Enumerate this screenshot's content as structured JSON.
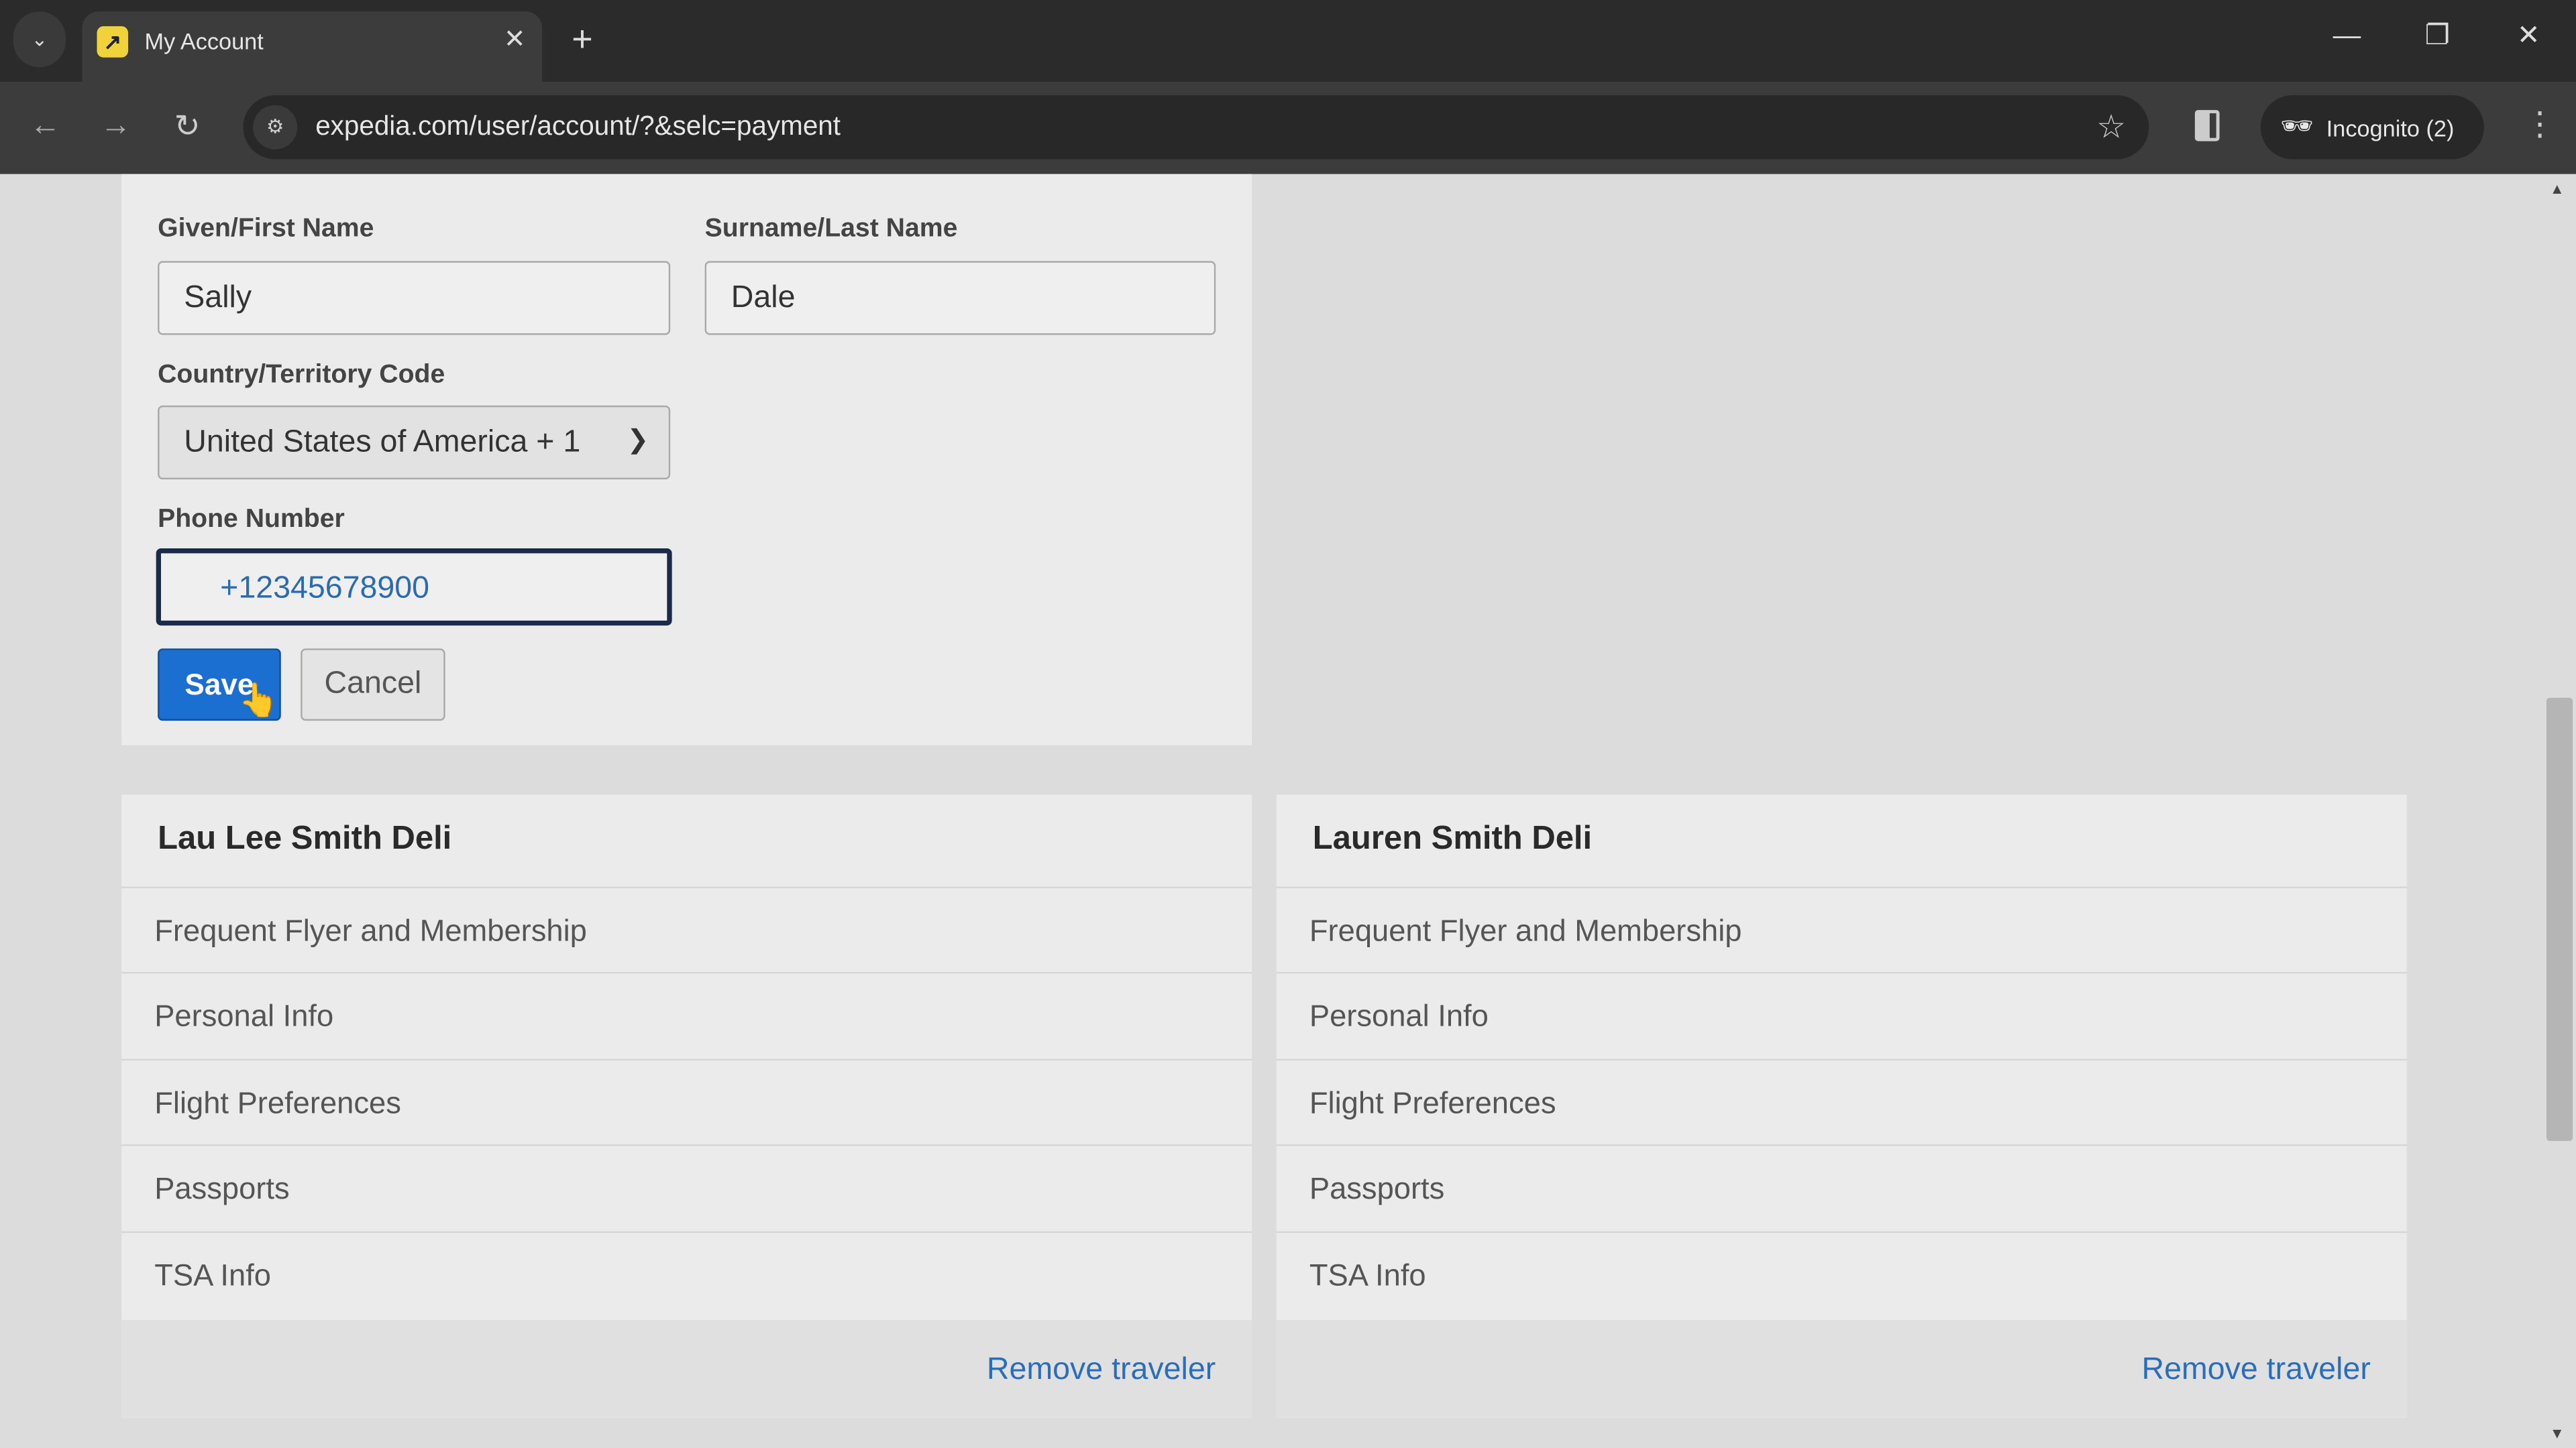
{
  "browser": {
    "tab_title": "My Account",
    "url": "expedia.com/user/account/?&selc=payment",
    "incognito_label": "Incognito (2)"
  },
  "form": {
    "first_name_label": "Given/First Name",
    "first_name_value": "Sally",
    "last_name_label": "Surname/Last Name",
    "last_name_value": "Dale",
    "country_label": "Country/Territory Code",
    "country_value": "United States of America + 1",
    "phone_label": "Phone Number",
    "phone_value": "+12345678900",
    "save_label": "Save",
    "cancel_label": "Cancel"
  },
  "travelers": [
    {
      "name": "Lau Lee Smith Deli",
      "items": [
        "Frequent Flyer and Membership",
        "Personal Info",
        "Flight Preferences",
        "Passports",
        "TSA Info"
      ],
      "remove_label": "Remove traveler"
    },
    {
      "name": "Lauren Smith Deli",
      "items": [
        "Frequent Flyer and Membership",
        "Personal Info",
        "Flight Preferences",
        "Passports",
        "TSA Info"
      ],
      "remove_label": "Remove traveler"
    }
  ],
  "colors": {
    "primary": "#1a6fd1",
    "link": "#2a6ebb"
  }
}
